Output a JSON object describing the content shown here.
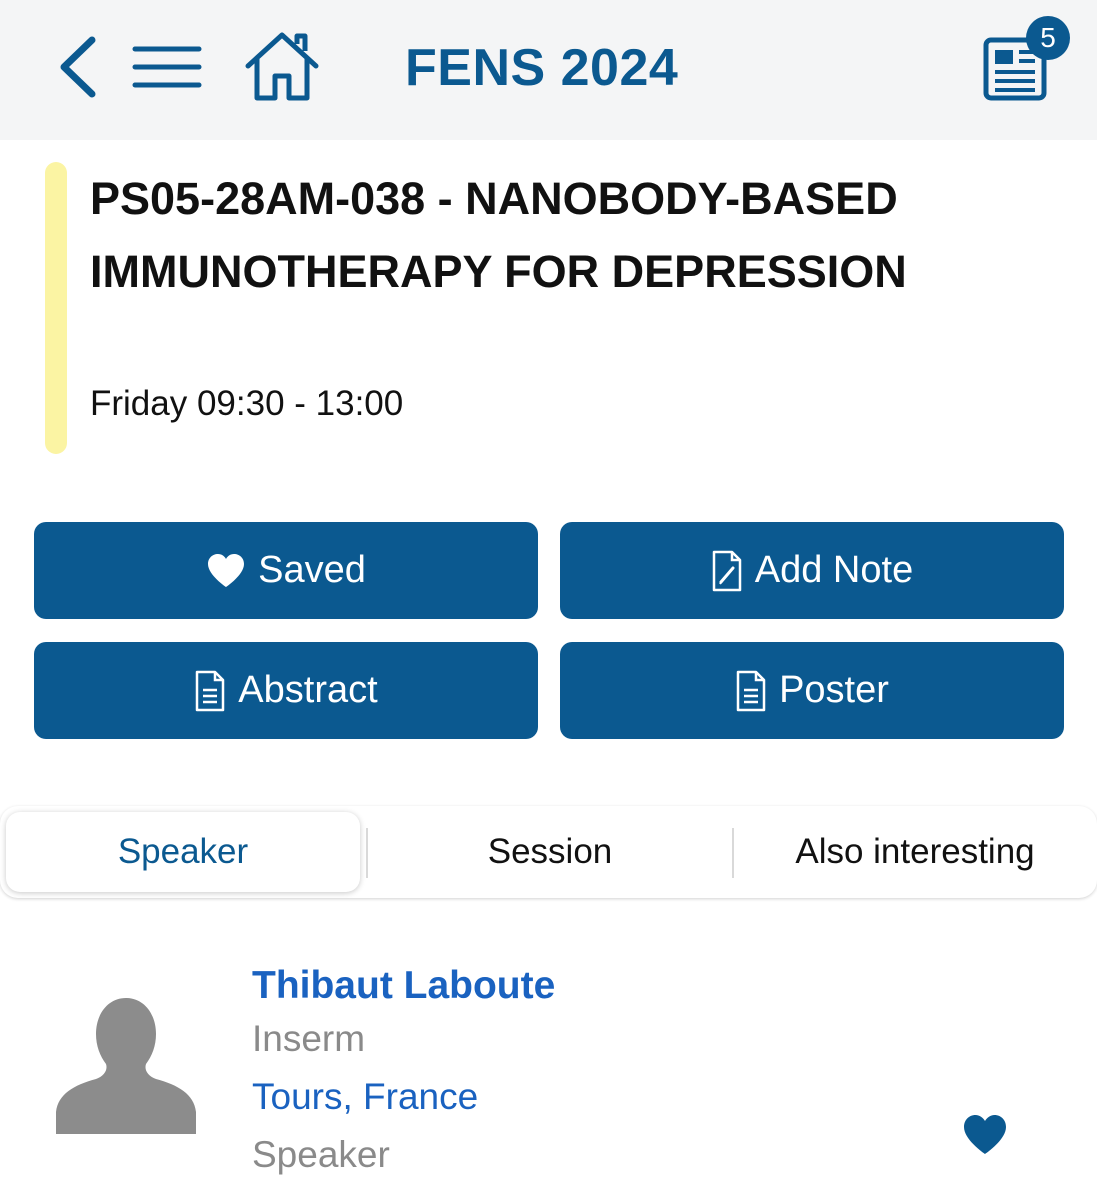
{
  "header": {
    "app_title": "FENS 2024",
    "news_badge_count": "5",
    "icons": [
      "back-icon",
      "menu-icon",
      "home-icon",
      "newspaper-icon"
    ]
  },
  "event": {
    "title": "PS05-28AM-038 - NANOBODY-BASED IMMUNOTHERAPY FOR DEPRESSION",
    "time": "Friday 09:30 - 13:00",
    "accent_color": "#fbf4a3"
  },
  "actions": {
    "saved_label": "Saved",
    "add_note_label": "Add Note",
    "abstract_label": "Abstract",
    "poster_label": "Poster"
  },
  "tabs": {
    "speaker": "Speaker",
    "session": "Session",
    "also_interesting": "Also interesting",
    "selected": "Speaker"
  },
  "speaker": {
    "name": "Thibaut Laboute",
    "organization": "Inserm",
    "location": "Tours, France",
    "role": "Speaker"
  },
  "colors": {
    "brand": "#0b5990",
    "link": "#1a62c0",
    "muted": "#8a8a8a"
  }
}
